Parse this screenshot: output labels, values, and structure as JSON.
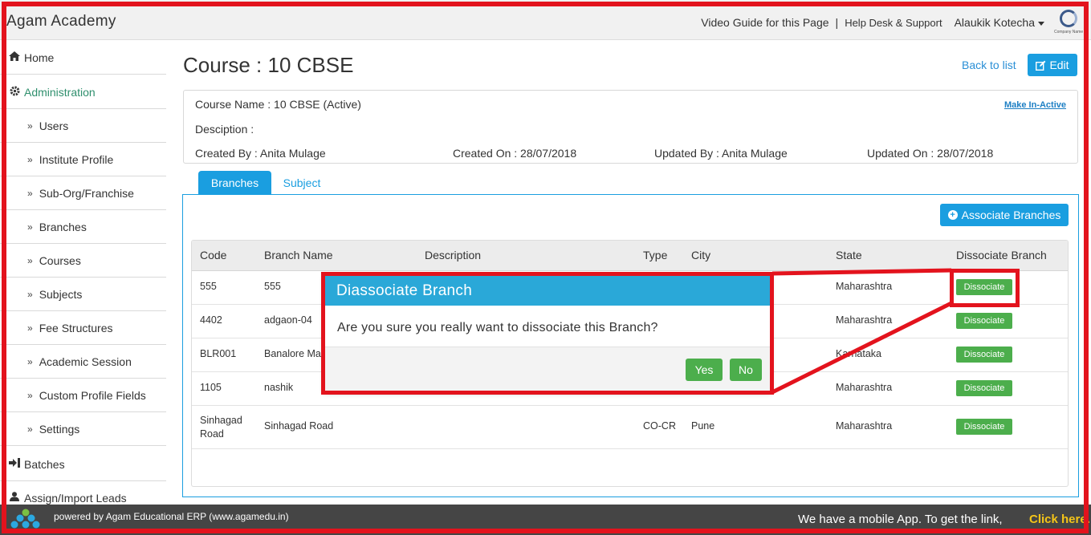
{
  "app": {
    "brand": "Agam Academy"
  },
  "topnav": {
    "video_guide": "Video Guide for this Page",
    "separator": "|",
    "help_desk": "Help Desk & Support",
    "user_name": "Alaukik Kotecha",
    "company_caption": "Company Name"
  },
  "sidebar": {
    "home": "Home",
    "administration": "Administration",
    "sub_items": [
      "Users",
      "Institute Profile",
      "Sub-Org/Franchise",
      "Branches",
      "Courses",
      "Subjects",
      "Fee Structures",
      "Academic Session",
      "Custom Profile Fields",
      "Settings"
    ],
    "batches": "Batches",
    "assign_leads": "Assign/Import Leads"
  },
  "header": {
    "title": "Course : 10 CBSE",
    "back_link": "Back to list",
    "edit_button": "Edit"
  },
  "info": {
    "course_name": "Course Name : 10 CBSE (Active)",
    "description": "Desciption :",
    "created_by": "Created By : Anita Mulage",
    "created_on": "Created On : 28/07/2018",
    "updated_by": "Updated By : Anita Mulage",
    "updated_on": "Updated On : 28/07/2018",
    "make_inactive": "Make In-Active"
  },
  "tabs": {
    "branches": "Branches",
    "subject": "Subject"
  },
  "table": {
    "associate_button": "Associate Branches",
    "columns": [
      "Code",
      "Branch Name",
      "Description",
      "Type",
      "City",
      "State",
      "Dissociate Branch"
    ],
    "rows": [
      {
        "code": "555",
        "name": "555",
        "description": "",
        "type": "",
        "city": "",
        "state": "Maharashtra",
        "action": "Dissociate"
      },
      {
        "code": "4402",
        "name": "adgaon-04",
        "description": "",
        "type": "",
        "city": "",
        "state": "Maharashtra",
        "action": "Dissociate"
      },
      {
        "code": "BLR001",
        "name": "Banalore Ma",
        "description": "",
        "type": "",
        "city": "",
        "state": "Karnataka",
        "action": "Dissociate"
      },
      {
        "code": "1105",
        "name": "nashik",
        "description": "",
        "type": "",
        "city": "",
        "state": "Maharashtra",
        "action": "Dissociate"
      },
      {
        "code": "Sinhagad Road",
        "name": "Sinhagad Road",
        "description": "",
        "type": "CO-CR",
        "city": "Pune",
        "state": "Maharashtra",
        "action": "Dissociate"
      }
    ]
  },
  "modal": {
    "title": "Diassociate Branch",
    "message": "Are you sure you really want to dissociate this Branch?",
    "yes": "Yes",
    "no": "No"
  },
  "footer": {
    "powered_by": "powered by Agam Educational ERP (www.agamedu.in)",
    "mobile_text": "We have a mobile App. To get the link,",
    "click_here": "Click here."
  },
  "colors": {
    "primary": "#1a9ee0",
    "success": "#4cae4c",
    "annotation_red": "#e3131d",
    "modal_header": "#2aa8d8",
    "footer_bg": "#454545",
    "footer_link": "#f5c518"
  },
  "icons": {
    "home": "home-icon",
    "administration": "gear-icon",
    "sub_item": "double-chevron-right-icon",
    "batches": "sign-in-icon",
    "assign_leads": "user-icon",
    "edit": "edit-icon",
    "associate": "plus-circle-icon",
    "user_menu": "caret-down-icon"
  }
}
